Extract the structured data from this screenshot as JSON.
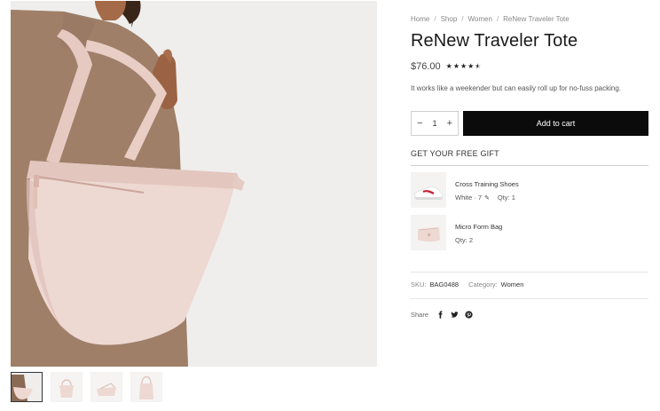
{
  "breadcrumb": {
    "items": [
      "Home",
      "Shop",
      "Women"
    ],
    "current": "ReNew Traveler Tote",
    "separator": "/"
  },
  "product": {
    "title": "ReNew Traveler Tote",
    "price": "$76.00",
    "rating": 4.5,
    "rating_max": 5,
    "description": "It works like a weekender but can easily roll up for no-fuss packing."
  },
  "purchase": {
    "quantity": "1",
    "minus": "−",
    "plus": "+",
    "add_to_cart": "Add to cart"
  },
  "gifts": {
    "heading": "GET YOUR FREE GIFT",
    "items": [
      {
        "name": "Cross Training Shoes",
        "variant": "White · 7",
        "qty": "Qty: 1"
      },
      {
        "name": "Micro Form Bag",
        "variant": "",
        "qty": "Qty: 2"
      }
    ]
  },
  "meta": {
    "sku_label": "SKU:",
    "sku": "BAG0488",
    "category_label": "Category:",
    "category": "Women"
  },
  "share": {
    "label": "Share",
    "icons": [
      "facebook-icon",
      "twitter-icon",
      "pinterest-icon"
    ]
  },
  "colors": {
    "bag_pink": "#eed8d2",
    "button_black": "#0b0b0b",
    "shoe_red": "#c8202d"
  }
}
